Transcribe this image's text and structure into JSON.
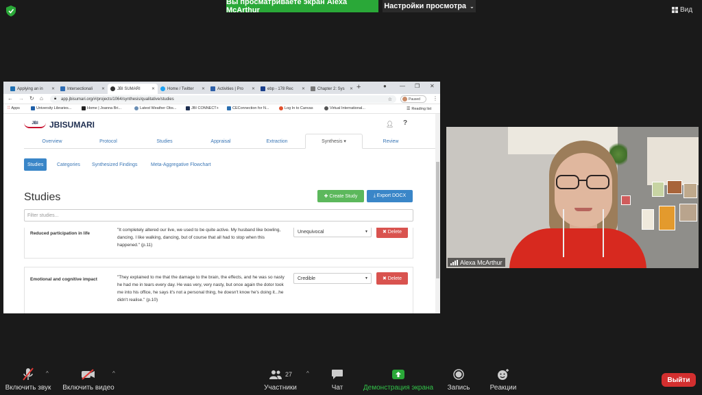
{
  "zoom": {
    "share_banner": "Вы просматриваете экран Alexa McArthur",
    "view_options": "Настройки просмотра",
    "view_button": "Вид",
    "participant_name": "Alexa McArthur",
    "toolbar": {
      "mute": "Включить звук",
      "video": "Включить видео",
      "participants": "Участники",
      "participants_count": "27",
      "chat": "Чат",
      "share": "Демонстрация экрана",
      "record": "Запись",
      "reactions": "Реакции",
      "end": "Выйти"
    }
  },
  "browser": {
    "tabs": [
      {
        "title": "Applying an in",
        "color": "#1f6fb2"
      },
      {
        "title": "Intersectionali",
        "color": "#2e6db4"
      },
      {
        "title": "JBI SUMARI",
        "color": "#333333"
      },
      {
        "title": "Home / Twitter",
        "color": "#1da1f2"
      },
      {
        "title": "Activities | Pro",
        "color": "#2d5fa8"
      },
      {
        "title": "ebp - 178 Rec",
        "color": "#1a3f8c"
      },
      {
        "title": "Chapter 2: Sys",
        "color": "#777777"
      }
    ],
    "url": "app.jbisumari.org/#/projects/1064/synthesis/qualitative/studies",
    "profile_status": "Paused",
    "bookmarks": [
      "Apps",
      "University Libraries...",
      "Home | Joanna Bri...",
      "Latest Weather Obs...",
      "JBI CONNECT+",
      "CEConnection for N...",
      "Log In to Canvas",
      "Virtual International...",
      "Reading list"
    ]
  },
  "app": {
    "logo_small": "JBI",
    "logo_name": "JBISUMARI",
    "nav_tabs": [
      "Overview",
      "Protocol",
      "Studies",
      "Appraisal",
      "Extraction",
      "Synthesis ▾",
      "Review"
    ],
    "sub_tabs": [
      "Studies",
      "Categories",
      "Synthesized Findings",
      "Meta-Aggregative Flowchart"
    ],
    "page_title": "Studies",
    "create_button": "✚ Create Study",
    "export_button": "⤓ Export DOCX",
    "filter_placeholder": "Filter studies...",
    "rows": [
      {
        "theme": "Reduced participation in life",
        "quote": "\"It completely altered our live, we used to be quite active. My husband like bowling, dancing. I like walking, dancing, but of course that all had to stop when this happened.\" (p.11)",
        "credibility": "Unequivocal",
        "delete": "✖ Delete"
      },
      {
        "theme": "Emotional and cognitive impact",
        "quote": "\"They explained to me that the damage to the brain, the effects, and he was so nasty he had me in tears every day. He was very, very nasty, but once again the dotor took me into his office, he says it's not a personal thing, he doesn't know he's doing it...he didn't realise.\" (p.10)",
        "credibility": "Credible",
        "delete": "✖ Delete"
      }
    ]
  },
  "colors": {
    "zoom_green": "#2aa838",
    "create_green": "#5cb85c",
    "primary_blue": "#3a86c8",
    "delete_red": "#d9534f",
    "end_red": "#d32f2f"
  }
}
